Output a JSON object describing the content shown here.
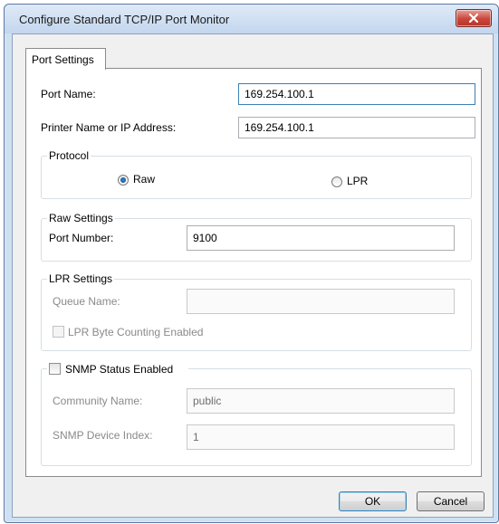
{
  "window": {
    "title": "Configure Standard TCP/IP Port Monitor",
    "close_icon": "close-icon"
  },
  "tabs": [
    {
      "label": "Port Settings",
      "selected": true
    }
  ],
  "port_name": {
    "label": "Port Name:",
    "value": "169.254.100.1"
  },
  "printer_name": {
    "label": "Printer Name or IP Address:",
    "value": "169.254.100.1"
  },
  "protocol": {
    "title": "Protocol",
    "options": [
      {
        "label": "Raw",
        "selected": true
      },
      {
        "label": "LPR",
        "selected": false
      }
    ]
  },
  "raw_settings": {
    "title": "Raw Settings",
    "port_number_label": "Port Number:",
    "port_number_value": "9100"
  },
  "lpr_settings": {
    "title": "LPR Settings",
    "queue_name_label": "Queue Name:",
    "queue_name_value": "",
    "byte_counting_label": "LPR Byte Counting Enabled",
    "byte_counting_checked": false
  },
  "snmp": {
    "enabled_label": "SNMP Status Enabled",
    "enabled_checked": false,
    "community_label": "Community Name:",
    "community_value": "public",
    "device_index_label": "SNMP Device Index:",
    "device_index_value": "1"
  },
  "buttons": {
    "ok": "OK",
    "cancel": "Cancel"
  }
}
